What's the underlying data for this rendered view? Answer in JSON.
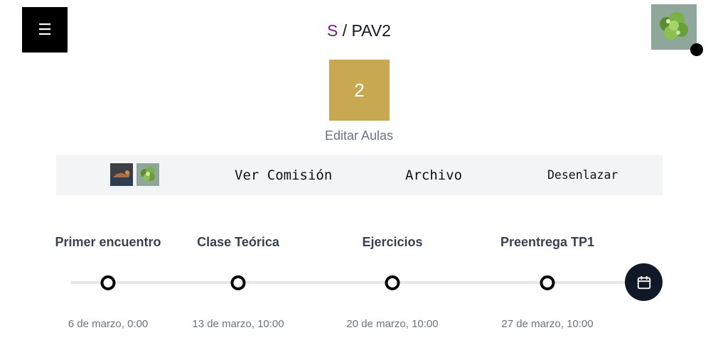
{
  "header": {
    "menu_icon": "menu-icon",
    "breadcrumb": {
      "first": "S",
      "separator": "/",
      "current": "PAV2"
    },
    "avatar_icon": "avatar-plant-image"
  },
  "counter": {
    "value": "2",
    "edit_label": "Editar Aulas"
  },
  "actions": {
    "ver_comision": "Ver Comisión",
    "archivo": "Archivo",
    "desenlazar": "Desenlazar"
  },
  "timeline": {
    "events": [
      {
        "title": "Primer encuentro",
        "date": "6 de marzo, 0:00"
      },
      {
        "title": "Clase Teórica",
        "date": "13 de marzo, 10:00"
      },
      {
        "title": "Ejercicios",
        "date": "20 de marzo, 10:00"
      },
      {
        "title": "Preentrega TP1",
        "date": "27 de marzo, 10:00"
      }
    ],
    "calendar_icon": "calendar-icon"
  },
  "colors": {
    "accent_purple": "#7a1a8c",
    "tile_gold": "#c8a850",
    "action_bar": "#f3f4f6",
    "calendar_button": "#111827"
  }
}
